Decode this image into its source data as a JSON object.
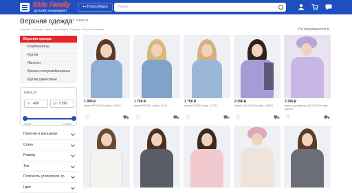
{
  "header": {
    "logo_main": "Kids Family",
    "logo_sub": "детский гипермаркет",
    "city": "г.Новосибирск",
    "search_placeholder": "Поиск",
    "accent": "#1f4fbf"
  },
  "page": {
    "title": "Верхняя одежда",
    "count": "179 товаров",
    "breadcrumbs": "Главная / Одежда, обувь, аксессуары / Одежда / Верхняя одежда",
    "sort": "По популярности"
  },
  "sidebar": {
    "active": "Верхняя одежда",
    "items": [
      "Комбинезоны",
      "Куртки",
      "Жилеты",
      "Брюки и полукомбинезоны",
      "Куртки джинсовые"
    ]
  },
  "price_filter": {
    "label": "Цена, ₽",
    "from_prefix": "от",
    "from": "490",
    "to_prefix": "до",
    "to": "3 290",
    "min_label": "490 ₽",
    "max_label": "3 290 ₽"
  },
  "filters": [
    "Наличие в магазинах",
    "Сезон",
    "Размер",
    "Тип",
    "Плотность утеплителя, гр",
    "Цвет"
  ],
  "products": [
    {
      "price": "1 990 ₽",
      "desc": "Куртка RF.90.5024 Incity, 174676"
    },
    {
      "price": "1 750 ₽",
      "desc": "Куртка RF.5521 Incity, 177214"
    },
    {
      "price": "1 750 ₽",
      "desc": "Куртка RF.5521 Incity, 177215"
    },
    {
      "price": "2 290 ₽",
      "desc": "Куртка JW.2Y3422A Incity, 169873"
    },
    {
      "price": "2 290 ₽",
      "desc": "Куртка для девочки 21K5 12329 Incity, 202375"
    },
    {
      "price": "",
      "desc": ""
    },
    {
      "price": "",
      "desc": ""
    },
    {
      "price": "",
      "desc": ""
    },
    {
      "price": "",
      "desc": ""
    },
    {
      "price": "",
      "desc": ""
    }
  ]
}
